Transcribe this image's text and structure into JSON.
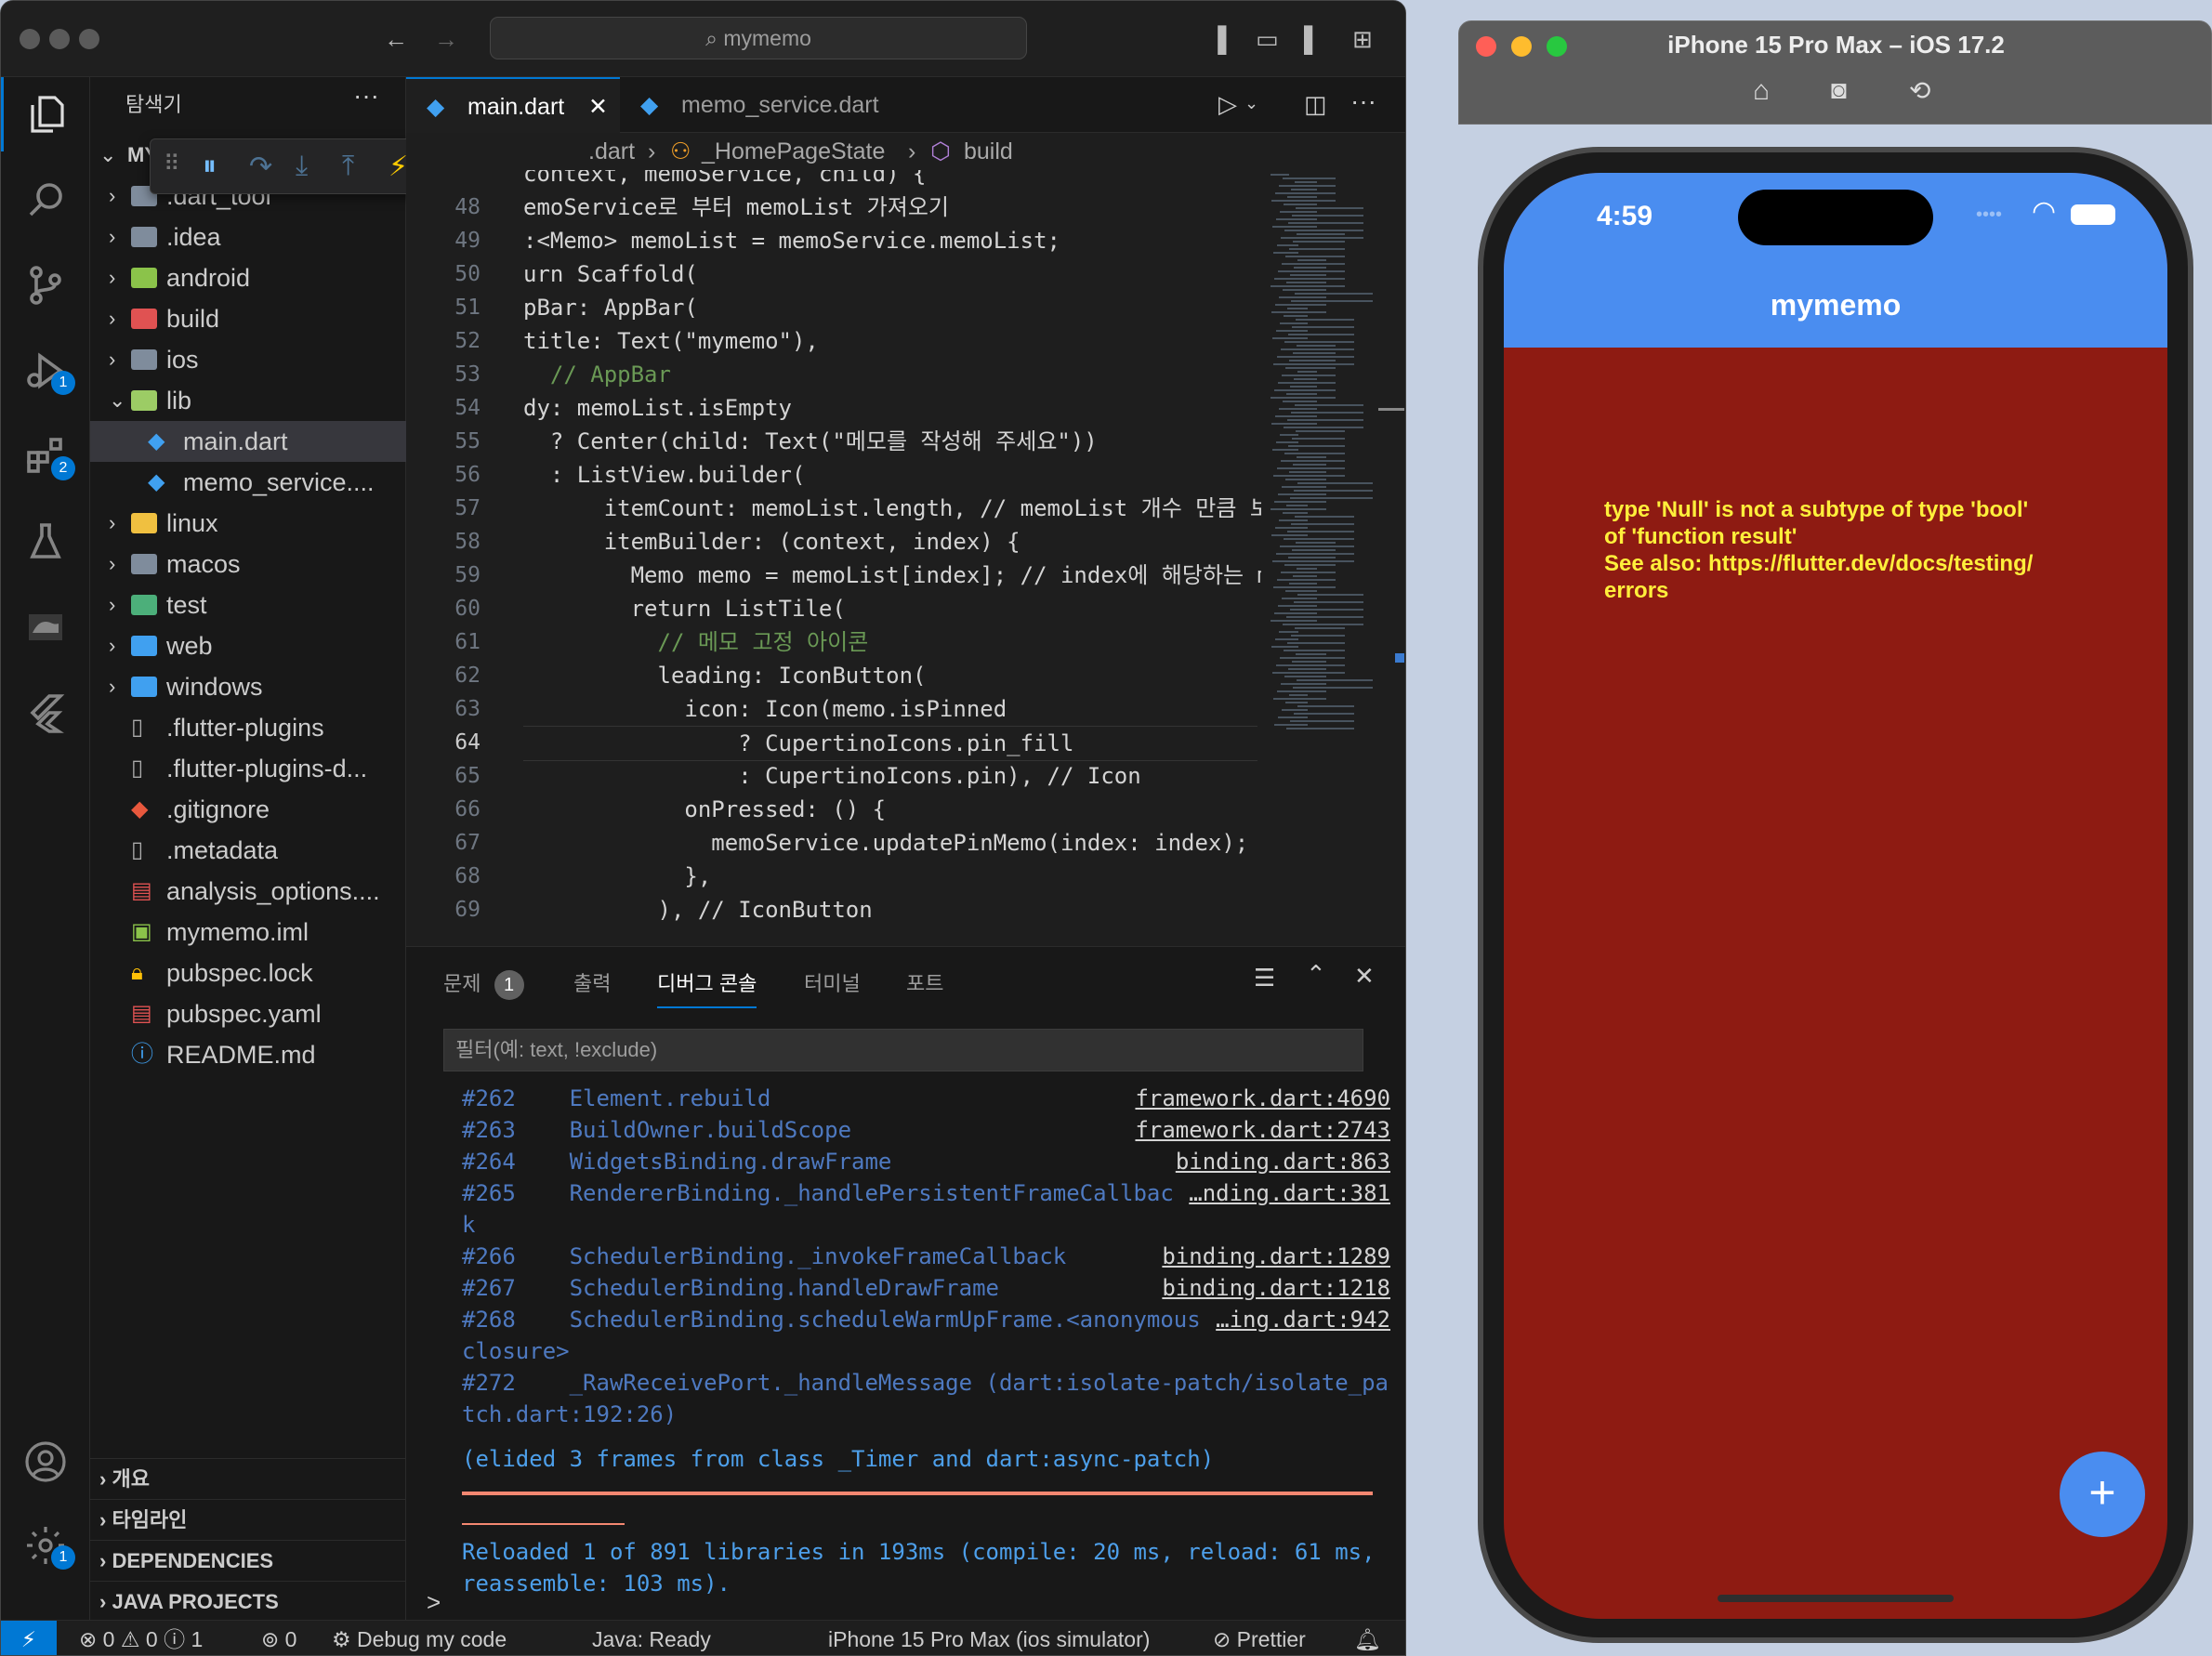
{
  "vscode": {
    "command_center": "mymemo",
    "sidebar": {
      "title": "탐색기",
      "root_label": "MY",
      "items": [
        {
          "label": ".dart_tool",
          "kind": "folder"
        },
        {
          "label": ".idea",
          "kind": "folder"
        },
        {
          "label": "android",
          "kind": "folder"
        },
        {
          "label": "build",
          "kind": "folder"
        },
        {
          "label": "ios",
          "kind": "folder"
        },
        {
          "label": "lib",
          "kind": "folder-open"
        },
        {
          "label": "main.dart",
          "kind": "dart"
        },
        {
          "label": "memo_service....",
          "kind": "dart"
        },
        {
          "label": "linux",
          "kind": "folder"
        },
        {
          "label": "macos",
          "kind": "folder"
        },
        {
          "label": "test",
          "kind": "folder"
        },
        {
          "label": "web",
          "kind": "folder"
        },
        {
          "label": "windows",
          "kind": "folder"
        },
        {
          "label": ".flutter-plugins",
          "kind": "file"
        },
        {
          "label": ".flutter-plugins-d...",
          "kind": "file"
        },
        {
          "label": ".gitignore",
          "kind": "git"
        },
        {
          "label": ".metadata",
          "kind": "file"
        },
        {
          "label": "analysis_options....",
          "kind": "yaml"
        },
        {
          "label": "mymemo.iml",
          "kind": "iml"
        },
        {
          "label": "pubspec.lock",
          "kind": "lock"
        },
        {
          "label": "pubspec.yaml",
          "kind": "yaml"
        },
        {
          "label": "README.md",
          "kind": "info"
        }
      ],
      "sections": [
        "개요",
        "타임라인",
        "DEPENDENCIES",
        "JAVA PROJECTS"
      ]
    },
    "activity_badges": {
      "debug": "1",
      "extensions": "2",
      "settings": "1"
    },
    "tabs": [
      {
        "label": "main.dart",
        "active": true
      },
      {
        "label": "memo_service.dart",
        "active": false
      }
    ],
    "breadcrumb": {
      "file": ".dart",
      "class": "_HomePageState",
      "method": "build"
    },
    "code": [
      {
        "n": "",
        "t": "context, memoService, child) {"
      },
      {
        "n": "48",
        "t": "emoService로 부터 memoList 가져오기"
      },
      {
        "n": "49",
        "t": ":<Memo> memoList = memoService.memoList;"
      },
      {
        "n": "50",
        "t": "urn Scaffold("
      },
      {
        "n": "51",
        "t": "pBar: AppBar("
      },
      {
        "n": "52",
        "t": "title: Text(\"mymemo\"),"
      },
      {
        "n": "53",
        "t": "  // AppBar"
      },
      {
        "n": "54",
        "t": "dy: memoList.isEmpty"
      },
      {
        "n": "55",
        "t": "  ? Center(child: Text(\"메모를 작성해 주세요\"))"
      },
      {
        "n": "56",
        "t": "  : ListView.builder("
      },
      {
        "n": "57",
        "t": "      itemCount: memoList.length, // memoList 개수 만큼 보"
      },
      {
        "n": "58",
        "t": "      itemBuilder: (context, index) {"
      },
      {
        "n": "59",
        "t": "        Memo memo = memoList[index]; // index에 해당하는 m"
      },
      {
        "n": "60",
        "t": "        return ListTile("
      },
      {
        "n": "61",
        "t": "          // 메모 고정 아이콘"
      },
      {
        "n": "62",
        "t": "          leading: IconButton("
      },
      {
        "n": "63",
        "t": "            icon: Icon(memo.isPinned"
      },
      {
        "n": "64",
        "t": "                ? CupertinoIcons.pin_fill"
      },
      {
        "n": "65",
        "t": "                : CupertinoIcons.pin), // Icon"
      },
      {
        "n": "66",
        "t": "            onPressed: () {"
      },
      {
        "n": "67",
        "t": "              memoService.updatePinMemo(index: index);"
      },
      {
        "n": "68",
        "t": "            },"
      },
      {
        "n": "69",
        "t": "          ), // IconButton"
      }
    ],
    "panel": {
      "tabs": [
        "문제",
        "출력",
        "디버그 콘솔",
        "터미널",
        "포트"
      ],
      "problems_count": "1",
      "filter_placeholder": "필터(예: text, !exclude)",
      "console": [
        {
          "t": "#262    Element.rebuild",
          "ref": "framework.dart:4690"
        },
        {
          "t": "#263    BuildOwner.buildScope",
          "ref": "framework.dart:2743"
        },
        {
          "t": "#264    WidgetsBinding.drawFrame",
          "ref": "binding.dart:863"
        },
        {
          "t": "#265    RendererBinding._handlePersistentFrameCallbac",
          "ref": "…nding.dart:381"
        },
        {
          "t": "k",
          "ref": ""
        },
        {
          "t": "#266    SchedulerBinding._invokeFrameCallback",
          "ref": "binding.dart:1289"
        },
        {
          "t": "#267    SchedulerBinding.handleDrawFrame",
          "ref": "binding.dart:1218"
        },
        {
          "t": "#268    SchedulerBinding.scheduleWarmUpFrame.<anonymous",
          "ref": "…ing.dart:942"
        },
        {
          "t": "closure>",
          "ref": ""
        },
        {
          "t": "#272    _RawReceivePort._handleMessage (dart:isolate-patch/isolate_pa",
          "ref": ""
        },
        {
          "t": "tch.dart:192:26)",
          "ref": ""
        }
      ],
      "elided": "(elided 3 frames from class _Timer and dart:async-patch)",
      "reload1": "Reloaded 1 of 891 libraries in 193ms (compile: 20 ms, reload: 61 ms,",
      "reload2": "reassemble: 103 ms).",
      "prompt": ">"
    },
    "status": {
      "errors": "0",
      "warnings": "0",
      "info": "1",
      "ports": "0",
      "debug": "Debug my code",
      "java": "Java: Ready",
      "device": "iPhone 15 Pro Max (ios simulator)",
      "prettier": "Prettier"
    }
  },
  "simulator": {
    "window_title": "iPhone 15 Pro Max – iOS 17.2",
    "time": "4:59",
    "app_title": "mymemo",
    "error_lines": [
      "type 'Null' is not a subtype of type 'bool'",
      "of 'function result'",
      "See also: https://flutter.dev/docs/testing/",
      "errors"
    ],
    "fab_label": "+"
  },
  "colors": {
    "editor_bg": "#1e1e1e",
    "accent": "#0078d4",
    "appbar": "#4a8df0",
    "error_bg": "#8e1b12",
    "error_text": "#ffef3b"
  }
}
